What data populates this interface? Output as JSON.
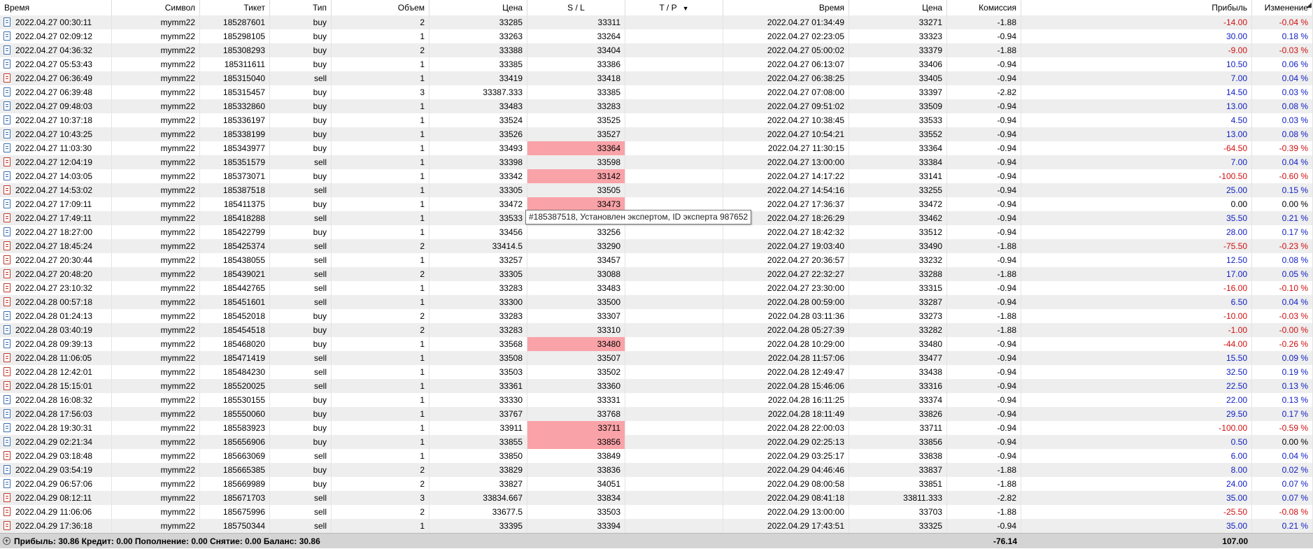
{
  "columns": [
    {
      "key": "time",
      "label": "Время",
      "align": "l"
    },
    {
      "key": "symbol",
      "label": "Символ",
      "align": "r"
    },
    {
      "key": "ticket",
      "label": "Тикет",
      "align": "r"
    },
    {
      "key": "type",
      "label": "Тип",
      "align": "r"
    },
    {
      "key": "volume",
      "label": "Объем",
      "align": "r"
    },
    {
      "key": "price",
      "label": "Цена",
      "align": "r"
    },
    {
      "key": "sl",
      "label": "S / L",
      "align": "r"
    },
    {
      "key": "tp",
      "label": "T / P",
      "align": "r",
      "sort_icon": "sort-desc-icon"
    },
    {
      "key": "close_time",
      "label": "Время",
      "align": "r"
    },
    {
      "key": "close_price",
      "label": "Цена",
      "align": "r"
    },
    {
      "key": "commission",
      "label": "Комиссия",
      "align": "r"
    },
    {
      "key": "swap",
      "label": "",
      "align": "r"
    },
    {
      "key": "profit",
      "label": "Прибыль",
      "align": "r"
    },
    {
      "key": "change",
      "label": "Изменение",
      "align": "r"
    }
  ],
  "colors": {
    "sl_highlight": "#f9a3a8",
    "negative": "#d01010",
    "positive": "#1020c0",
    "row_alt": "#eeeeee",
    "footer_bg": "#d4d4d4"
  },
  "rows": [
    {
      "time": "2022.04.27 00:30:11",
      "symbol": "mymm22",
      "ticket": "185287601",
      "type": "buy",
      "volume": "2",
      "price": "33285",
      "sl": "33311",
      "tp": "",
      "close_time": "2022.04.27 01:34:49",
      "close_price": "33271",
      "commission": "-1.88",
      "profit": "-14.00",
      "change": "-0.04 %",
      "sl_hit": false
    },
    {
      "time": "2022.04.27 02:09:12",
      "symbol": "mymm22",
      "ticket": "185298105",
      "type": "buy",
      "volume": "1",
      "price": "33263",
      "sl": "33264",
      "tp": "",
      "close_time": "2022.04.27 02:23:05",
      "close_price": "33323",
      "commission": "-0.94",
      "profit": "30.00",
      "change": "0.18 %",
      "sl_hit": false
    },
    {
      "time": "2022.04.27 04:36:32",
      "symbol": "mymm22",
      "ticket": "185308293",
      "type": "buy",
      "volume": "2",
      "price": "33388",
      "sl": "33404",
      "tp": "",
      "close_time": "2022.04.27 05:00:02",
      "close_price": "33379",
      "commission": "-1.88",
      "profit": "-9.00",
      "change": "-0.03 %",
      "sl_hit": false
    },
    {
      "time": "2022.04.27 05:53:43",
      "symbol": "mymm22",
      "ticket": "185311611",
      "type": "buy",
      "volume": "1",
      "price": "33385",
      "sl": "33386",
      "tp": "",
      "close_time": "2022.04.27 06:13:07",
      "close_price": "33406",
      "commission": "-0.94",
      "profit": "10.50",
      "change": "0.06 %",
      "sl_hit": false
    },
    {
      "time": "2022.04.27 06:36:49",
      "symbol": "mymm22",
      "ticket": "185315040",
      "type": "sell",
      "volume": "1",
      "price": "33419",
      "sl": "33418",
      "tp": "",
      "close_time": "2022.04.27 06:38:25",
      "close_price": "33405",
      "commission": "-0.94",
      "profit": "7.00",
      "change": "0.04 %",
      "sl_hit": false
    },
    {
      "time": "2022.04.27 06:39:48",
      "symbol": "mymm22",
      "ticket": "185315457",
      "type": "buy",
      "volume": "3",
      "price": "33387.333",
      "sl": "33385",
      "tp": "",
      "close_time": "2022.04.27 07:08:00",
      "close_price": "33397",
      "commission": "-2.82",
      "profit": "14.50",
      "change": "0.03 %",
      "sl_hit": false
    },
    {
      "time": "2022.04.27 09:48:03",
      "symbol": "mymm22",
      "ticket": "185332860",
      "type": "buy",
      "volume": "1",
      "price": "33483",
      "sl": "33283",
      "tp": "",
      "close_time": "2022.04.27 09:51:02",
      "close_price": "33509",
      "commission": "-0.94",
      "profit": "13.00",
      "change": "0.08 %",
      "sl_hit": false
    },
    {
      "time": "2022.04.27 10:37:18",
      "symbol": "mymm22",
      "ticket": "185336197",
      "type": "buy",
      "volume": "1",
      "price": "33524",
      "sl": "33525",
      "tp": "",
      "close_time": "2022.04.27 10:38:45",
      "close_price": "33533",
      "commission": "-0.94",
      "profit": "4.50",
      "change": "0.03 %",
      "sl_hit": false
    },
    {
      "time": "2022.04.27 10:43:25",
      "symbol": "mymm22",
      "ticket": "185338199",
      "type": "buy",
      "volume": "1",
      "price": "33526",
      "sl": "33527",
      "tp": "",
      "close_time": "2022.04.27 10:54:21",
      "close_price": "33552",
      "commission": "-0.94",
      "profit": "13.00",
      "change": "0.08 %",
      "sl_hit": false
    },
    {
      "time": "2022.04.27 11:03:30",
      "symbol": "mymm22",
      "ticket": "185343977",
      "type": "buy",
      "volume": "1",
      "price": "33493",
      "sl": "33364",
      "tp": "",
      "close_time": "2022.04.27 11:30:15",
      "close_price": "33364",
      "commission": "-0.94",
      "profit": "-64.50",
      "change": "-0.39 %",
      "sl_hit": true
    },
    {
      "time": "2022.04.27 12:04:19",
      "symbol": "mymm22",
      "ticket": "185351579",
      "type": "sell",
      "volume": "1",
      "price": "33398",
      "sl": "33598",
      "tp": "",
      "close_time": "2022.04.27 13:00:00",
      "close_price": "33384",
      "commission": "-0.94",
      "profit": "7.00",
      "change": "0.04 %",
      "sl_hit": false
    },
    {
      "time": "2022.04.27 14:03:05",
      "symbol": "mymm22",
      "ticket": "185373071",
      "type": "buy",
      "volume": "1",
      "price": "33342",
      "sl": "33142",
      "tp": "",
      "close_time": "2022.04.27 14:17:22",
      "close_price": "33141",
      "commission": "-0.94",
      "profit": "-100.50",
      "change": "-0.60 %",
      "sl_hit": true
    },
    {
      "time": "2022.04.27 14:53:02",
      "symbol": "mymm22",
      "ticket": "185387518",
      "type": "sell",
      "volume": "1",
      "price": "33305",
      "sl": "33505",
      "tp": "",
      "close_time": "2022.04.27 14:54:16",
      "close_price": "33255",
      "commission": "-0.94",
      "profit": "25.00",
      "change": "0.15 %",
      "sl_hit": false
    },
    {
      "time": "2022.04.27 17:09:11",
      "symbol": "mymm22",
      "ticket": "185411375",
      "type": "buy",
      "volume": "1",
      "price": "33472",
      "sl": "33473",
      "tp": "",
      "close_time": "2022.04.27 17:36:37",
      "close_price": "33472",
      "commission": "-0.94",
      "profit": "0.00",
      "change": "0.00 %",
      "sl_hit": true
    },
    {
      "time": "2022.04.27 17:49:11",
      "symbol": "mymm22",
      "ticket": "185418288",
      "type": "sell",
      "volume": "1",
      "price": "33533",
      "sl": "",
      "tp": "",
      "close_time": "2022.04.27 18:26:29",
      "close_price": "33462",
      "commission": "-0.94",
      "profit": "35.50",
      "change": "0.21 %",
      "sl_hit": false
    },
    {
      "time": "2022.04.27 18:27:00",
      "symbol": "mymm22",
      "ticket": "185422799",
      "type": "buy",
      "volume": "1",
      "price": "33456",
      "sl": "33256",
      "tp": "",
      "close_time": "2022.04.27 18:42:32",
      "close_price": "33512",
      "commission": "-0.94",
      "profit": "28.00",
      "change": "0.17 %",
      "sl_hit": false
    },
    {
      "time": "2022.04.27 18:45:24",
      "symbol": "mymm22",
      "ticket": "185425374",
      "type": "sell",
      "volume": "2",
      "price": "33414.5",
      "sl": "33290",
      "tp": "",
      "close_time": "2022.04.27 19:03:40",
      "close_price": "33490",
      "commission": "-1.88",
      "profit": "-75.50",
      "change": "-0.23 %",
      "sl_hit": false
    },
    {
      "time": "2022.04.27 20:30:44",
      "symbol": "mymm22",
      "ticket": "185438055",
      "type": "sell",
      "volume": "1",
      "price": "33257",
      "sl": "33457",
      "tp": "",
      "close_time": "2022.04.27 20:36:57",
      "close_price": "33232",
      "commission": "-0.94",
      "profit": "12.50",
      "change": "0.08 %",
      "sl_hit": false
    },
    {
      "time": "2022.04.27 20:48:20",
      "symbol": "mymm22",
      "ticket": "185439021",
      "type": "sell",
      "volume": "2",
      "price": "33305",
      "sl": "33088",
      "tp": "",
      "close_time": "2022.04.27 22:32:27",
      "close_price": "33288",
      "commission": "-1.88",
      "profit": "17.00",
      "change": "0.05 %",
      "sl_hit": false
    },
    {
      "time": "2022.04.27 23:10:32",
      "symbol": "mymm22",
      "ticket": "185442765",
      "type": "sell",
      "volume": "1",
      "price": "33283",
      "sl": "33483",
      "tp": "",
      "close_time": "2022.04.27 23:30:00",
      "close_price": "33315",
      "commission": "-0.94",
      "profit": "-16.00",
      "change": "-0.10 %",
      "sl_hit": false
    },
    {
      "time": "2022.04.28 00:57:18",
      "symbol": "mymm22",
      "ticket": "185451601",
      "type": "sell",
      "volume": "1",
      "price": "33300",
      "sl": "33500",
      "tp": "",
      "close_time": "2022.04.28 00:59:00",
      "close_price": "33287",
      "commission": "-0.94",
      "profit": "6.50",
      "change": "0.04 %",
      "sl_hit": false
    },
    {
      "time": "2022.04.28 01:24:13",
      "symbol": "mymm22",
      "ticket": "185452018",
      "type": "buy",
      "volume": "2",
      "price": "33283",
      "sl": "33307",
      "tp": "",
      "close_time": "2022.04.28 03:11:36",
      "close_price": "33273",
      "commission": "-1.88",
      "profit": "-10.00",
      "change": "-0.03 %",
      "sl_hit": false
    },
    {
      "time": "2022.04.28 03:40:19",
      "symbol": "mymm22",
      "ticket": "185454518",
      "type": "buy",
      "volume": "2",
      "price": "33283",
      "sl": "33310",
      "tp": "",
      "close_time": "2022.04.28 05:27:39",
      "close_price": "33282",
      "commission": "-1.88",
      "profit": "-1.00",
      "change": "-0.00 %",
      "sl_hit": false
    },
    {
      "time": "2022.04.28 09:39:13",
      "symbol": "mymm22",
      "ticket": "185468020",
      "type": "buy",
      "volume": "1",
      "price": "33568",
      "sl": "33480",
      "tp": "",
      "close_time": "2022.04.28 10:29:00",
      "close_price": "33480",
      "commission": "-0.94",
      "profit": "-44.00",
      "change": "-0.26 %",
      "sl_hit": true
    },
    {
      "time": "2022.04.28 11:06:05",
      "symbol": "mymm22",
      "ticket": "185471419",
      "type": "sell",
      "volume": "1",
      "price": "33508",
      "sl": "33507",
      "tp": "",
      "close_time": "2022.04.28 11:57:06",
      "close_price": "33477",
      "commission": "-0.94",
      "profit": "15.50",
      "change": "0.09 %",
      "sl_hit": false
    },
    {
      "time": "2022.04.28 12:42:01",
      "symbol": "mymm22",
      "ticket": "185484230",
      "type": "sell",
      "volume": "1",
      "price": "33503",
      "sl": "33502",
      "tp": "",
      "close_time": "2022.04.28 12:49:47",
      "close_price": "33438",
      "commission": "-0.94",
      "profit": "32.50",
      "change": "0.19 %",
      "sl_hit": false
    },
    {
      "time": "2022.04.28 15:15:01",
      "symbol": "mymm22",
      "ticket": "185520025",
      "type": "sell",
      "volume": "1",
      "price": "33361",
      "sl": "33360",
      "tp": "",
      "close_time": "2022.04.28 15:46:06",
      "close_price": "33316",
      "commission": "-0.94",
      "profit": "22.50",
      "change": "0.13 %",
      "sl_hit": false
    },
    {
      "time": "2022.04.28 16:08:32",
      "symbol": "mymm22",
      "ticket": "185530155",
      "type": "buy",
      "volume": "1",
      "price": "33330",
      "sl": "33331",
      "tp": "",
      "close_time": "2022.04.28 16:11:25",
      "close_price": "33374",
      "commission": "-0.94",
      "profit": "22.00",
      "change": "0.13 %",
      "sl_hit": false
    },
    {
      "time": "2022.04.28 17:56:03",
      "symbol": "mymm22",
      "ticket": "185550060",
      "type": "buy",
      "volume": "1",
      "price": "33767",
      "sl": "33768",
      "tp": "",
      "close_time": "2022.04.28 18:11:49",
      "close_price": "33826",
      "commission": "-0.94",
      "profit": "29.50",
      "change": "0.17 %",
      "sl_hit": false
    },
    {
      "time": "2022.04.28 19:30:31",
      "symbol": "mymm22",
      "ticket": "185583923",
      "type": "buy",
      "volume": "1",
      "price": "33911",
      "sl": "33711",
      "tp": "",
      "close_time": "2022.04.28 22:00:03",
      "close_price": "33711",
      "commission": "-0.94",
      "profit": "-100.00",
      "change": "-0.59 %",
      "sl_hit": true
    },
    {
      "time": "2022.04.29 02:21:34",
      "symbol": "mymm22",
      "ticket": "185656906",
      "type": "buy",
      "volume": "1",
      "price": "33855",
      "sl": "33856",
      "tp": "",
      "close_time": "2022.04.29 02:25:13",
      "close_price": "33856",
      "commission": "-0.94",
      "profit": "0.50",
      "change": "0.00 %",
      "sl_hit": true
    },
    {
      "time": "2022.04.29 03:18:48",
      "symbol": "mymm22",
      "ticket": "185663069",
      "type": "sell",
      "volume": "1",
      "price": "33850",
      "sl": "33849",
      "tp": "",
      "close_time": "2022.04.29 03:25:17",
      "close_price": "33838",
      "commission": "-0.94",
      "profit": "6.00",
      "change": "0.04 %",
      "sl_hit": false
    },
    {
      "time": "2022.04.29 03:54:19",
      "symbol": "mymm22",
      "ticket": "185665385",
      "type": "buy",
      "volume": "2",
      "price": "33829",
      "sl": "33836",
      "tp": "",
      "close_time": "2022.04.29 04:46:46",
      "close_price": "33837",
      "commission": "-1.88",
      "profit": "8.00",
      "change": "0.02 %",
      "sl_hit": false
    },
    {
      "time": "2022.04.29 06:57:06",
      "symbol": "mymm22",
      "ticket": "185669989",
      "type": "buy",
      "volume": "2",
      "price": "33827",
      "sl": "34051",
      "tp": "",
      "close_time": "2022.04.29 08:00:58",
      "close_price": "33851",
      "commission": "-1.88",
      "profit": "24.00",
      "change": "0.07 %",
      "sl_hit": false
    },
    {
      "time": "2022.04.29 08:12:11",
      "symbol": "mymm22",
      "ticket": "185671703",
      "type": "sell",
      "volume": "3",
      "price": "33834.667",
      "sl": "33834",
      "tp": "",
      "close_time": "2022.04.29 08:41:18",
      "close_price": "33811.333",
      "commission": "-2.82",
      "profit": "35.00",
      "change": "0.07 %",
      "sl_hit": false
    },
    {
      "time": "2022.04.29 11:06:06",
      "symbol": "mymm22",
      "ticket": "185675996",
      "type": "sell",
      "volume": "2",
      "price": "33677.5",
      "sl": "33503",
      "tp": "",
      "close_time": "2022.04.29 13:00:00",
      "close_price": "33703",
      "commission": "-1.88",
      "profit": "-25.50",
      "change": "-0.08 %",
      "sl_hit": false
    },
    {
      "time": "2022.04.29 17:36:18",
      "symbol": "mymm22",
      "ticket": "185750344",
      "type": "sell",
      "volume": "1",
      "price": "33395",
      "sl": "33394",
      "tp": "",
      "close_time": "2022.04.29 17:43:51",
      "close_price": "33325",
      "commission": "-0.94",
      "profit": "35.00",
      "change": "0.21 %",
      "sl_hit": false
    }
  ],
  "footer": {
    "summary": "Прибыль: 30.86  Кредит: 0.00  Пополнение: 0.00  Снятие: 0.00  Баланс: 30.86",
    "commission_total": "-76.14",
    "profit_total": "107.00"
  },
  "tooltip": {
    "text": "#185387518, Установлен экспертом, ID эксперта 987652"
  }
}
